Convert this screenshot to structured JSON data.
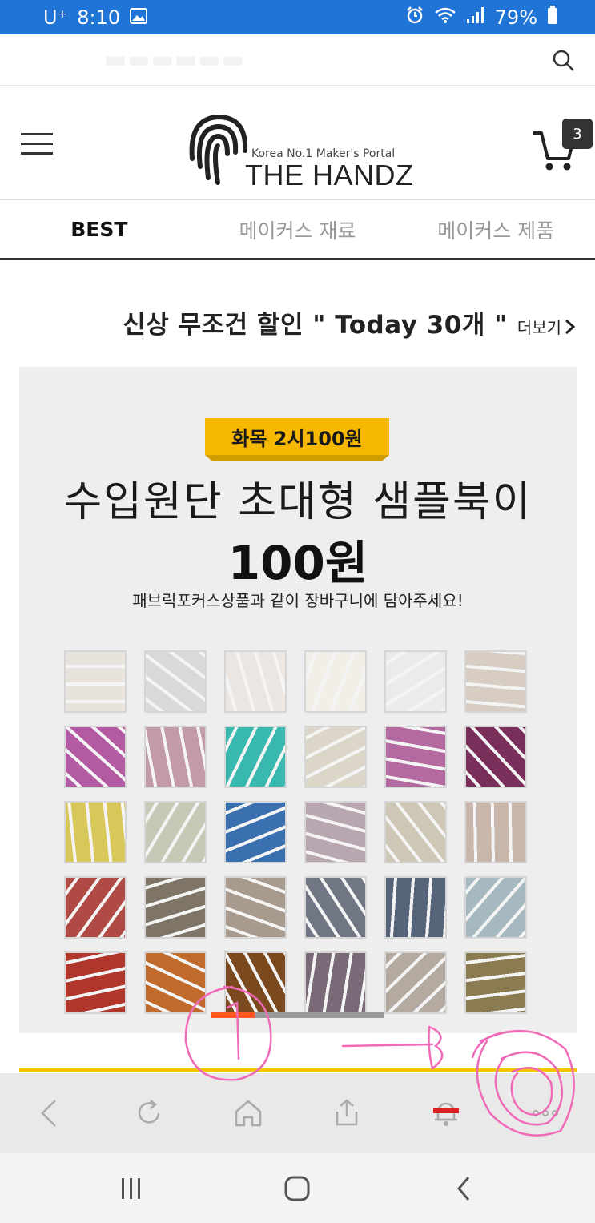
{
  "status_bar": {
    "carrier": "U⁺",
    "time": "8:10",
    "battery": "79%",
    "icons": [
      "gallery-icon",
      "alarm-icon",
      "wifi-icon",
      "signal-icon",
      "battery-icon"
    ]
  },
  "header": {
    "logo_sub": "Korea No.1 Maker's Portal",
    "logo_main": "THE HANDZ",
    "cart_count": "3"
  },
  "tabs": [
    {
      "label": "BEST",
      "active": true
    },
    {
      "label": "메이커스 재료",
      "active": false
    },
    {
      "label": "메이커스 제품",
      "active": false
    }
  ],
  "section": {
    "title": "신상 무조건 할인 \" Today 30개 \"",
    "more": "더보기"
  },
  "banner": {
    "pill": "화목 2시100원",
    "title": "수입원단 초대형 샘플북이",
    "price": "100원",
    "subtitle": "패브릭포커스상품과 같이 장바구니에 담아주세요!",
    "slide_progress": 0.25
  },
  "swatch_colors": [
    "#e7e2dc",
    "#d9d9d9",
    "#ece6e2",
    "#f2efe9",
    "#ebebeb",
    "#d8cdc2",
    "#b45aa2",
    "#c39aa8",
    "#39b8b0",
    "#dcd6c8",
    "#b46aa0",
    "#7a2e5a",
    "#d8c85a",
    "#c5c9b6",
    "#3a70b0",
    "#b8a6b0",
    "#cfc7b5",
    "#c9b6aa",
    "#b04a44",
    "#7f7566",
    "#a89a8c",
    "#707684",
    "#56647a",
    "#a6b8c0",
    "#b0352a",
    "#c06a2c",
    "#7a4a1e",
    "#7a6a78",
    "#b4aaa0",
    "#8a7c50"
  ],
  "colors": {
    "status_bar": "#1f74d6",
    "accent_yellow": "#f6b800",
    "progress": "#ff5a1f",
    "annotation": "#f06ab8"
  },
  "browser_toolbar": [
    "back-icon",
    "refresh-icon",
    "home-icon",
    "share-icon",
    "notification-icon",
    "more-icon"
  ],
  "system_nav": [
    "recent-apps-icon",
    "home-nav-icon",
    "back-nav-icon"
  ]
}
